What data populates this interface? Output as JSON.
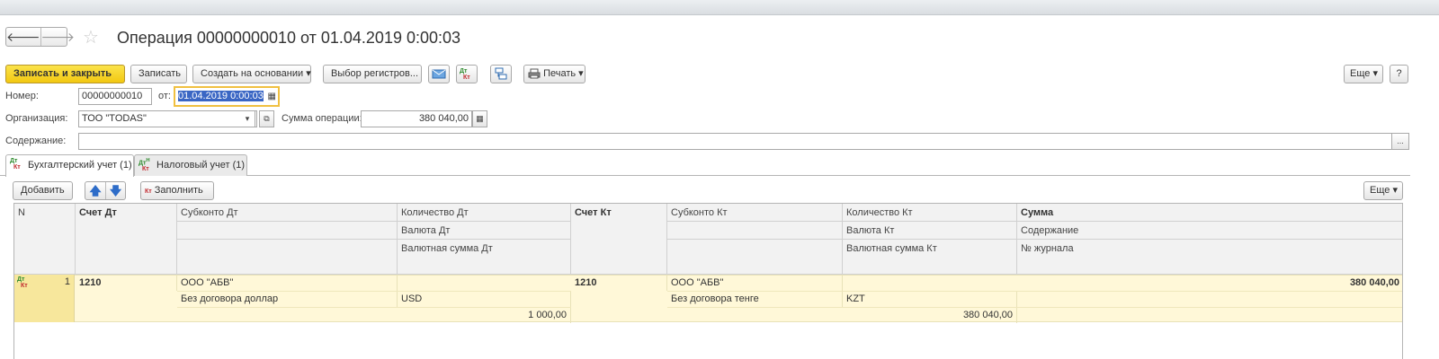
{
  "window": {
    "title": "Операция 00000000010 от 01.04.2019 0:00:03"
  },
  "toolbar": {
    "save_close": "Записать и закрыть",
    "save": "Записать",
    "create_based": "Создать на основании",
    "select_registers": "Выбор регистров...",
    "print": "Печать",
    "more": "Еще",
    "help": "?"
  },
  "form": {
    "number_label": "Номер:",
    "number_value": "00000000010",
    "date_label": "от:",
    "date_value": "01.04.2019  0:00:03",
    "org_label": "Организация:",
    "org_value": "ТОО \"TODAS\"",
    "sum_label": "Сумма операции:",
    "sum_value": "380 040,00",
    "content_label": "Содержание:",
    "content_value": "",
    "content_btn": "..."
  },
  "tabs": [
    {
      "label": "Бухгалтерский учет (1)",
      "active": true
    },
    {
      "label": "Налоговый учет (1)",
      "active": false
    }
  ],
  "table_toolbar": {
    "add": "Добавить",
    "fill": "Заполнить",
    "more": "Еще"
  },
  "table": {
    "headers": {
      "n": "N",
      "acc_dt": "Счет Дт",
      "sub_dt": "Субконто Дт",
      "qty_dt": "Количество Дт",
      "cur_dt": "Валюта Дт",
      "cursum_dt": "Валютная сумма Дт",
      "acc_kt": "Счет Кт",
      "sub_kt": "Субконто Кт",
      "qty_kt": "Количество Кт",
      "cur_kt": "Валюта Кт",
      "cursum_kt": "Валютная сумма Кт",
      "sum": "Сумма",
      "content": "Содержание",
      "journal": "№ журнала"
    },
    "rows": [
      {
        "n": "1",
        "acc_dt": "1210",
        "sub_dt_1": "ООО \"АБВ\"",
        "sub_dt_2": "Без договора доллар",
        "cur_dt": "USD",
        "cursum_dt": "1 000,00",
        "acc_kt": "1210",
        "sub_kt_1": "ООО \"АБВ\"",
        "sub_kt_2": "Без договора тенге",
        "cur_kt": "KZT",
        "cursum_kt": "380 040,00",
        "sum": "380 040,00"
      }
    ]
  }
}
